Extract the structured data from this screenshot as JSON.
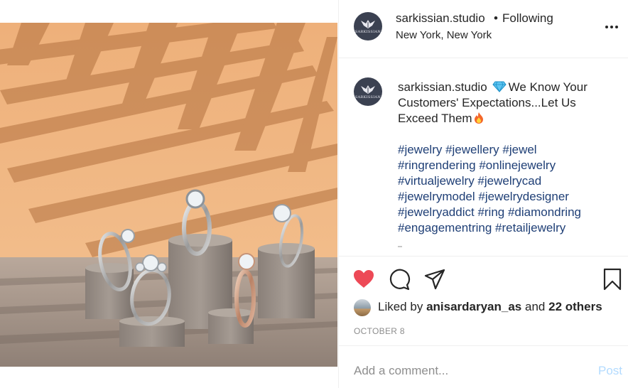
{
  "post": {
    "username": "sarkissian.studio",
    "follow_separator": "•",
    "follow_status": "Following",
    "location": "New York, New York",
    "avatar_brand": "SARKISSIAN",
    "more_icon": "more-horizontal-icon",
    "caption": {
      "username": "sarkissian.studio",
      "text": "We Know Your Customers' Expectations...Let Us Exceed Them",
      "hashtags": [
        "#jewelry #jewellery #jewel",
        "#ringrendering #onlinejewelry",
        "#virtualjewelry #jewelrycad",
        "#jewelrymodel #jewelrydesigner",
        "#jewelryaddict #ring #diamondring",
        "#engagementring #retailjewelry"
      ]
    },
    "actions": {
      "like_icon": "heart-filled-icon",
      "comment_icon": "comment-icon",
      "share_icon": "share-icon",
      "save_icon": "bookmark-icon"
    },
    "likes": {
      "prefix": "Liked by",
      "user": "anisardaryan_as",
      "conjunction": "and",
      "others": "22 others"
    },
    "date": "OCTOBER 8",
    "comment_placeholder": "Add a comment...",
    "post_label": "Post"
  },
  "colors": {
    "heart": "#ed4956",
    "hashtag": "#1f3f76",
    "avatar_bg": "#3b4151",
    "post_disabled": "#b3dbff",
    "wall": "#efb582"
  }
}
